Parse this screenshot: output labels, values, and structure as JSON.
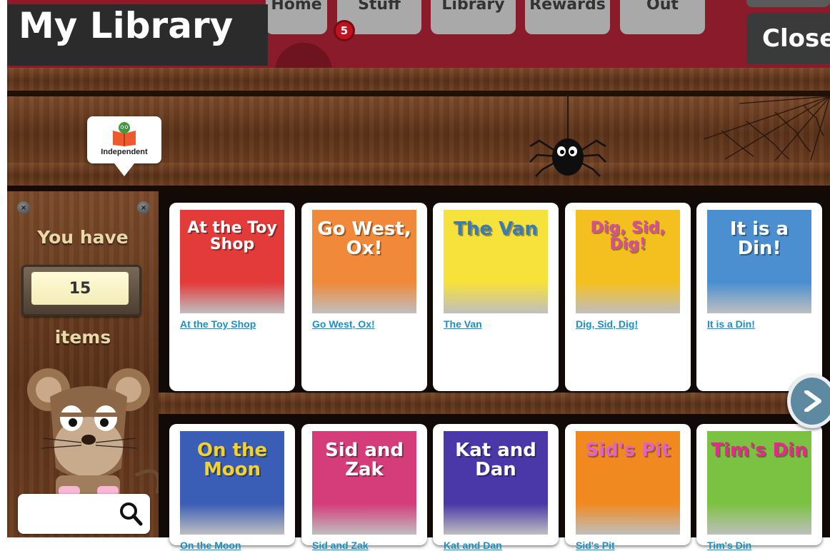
{
  "app": {
    "title": "My Library",
    "close_label": "Close"
  },
  "nav": {
    "tabs": [
      "Home",
      "Stuff",
      "Library",
      "Rewards",
      "Out"
    ],
    "badge_count": "5"
  },
  "shelf": {
    "tag_label": "Independent",
    "tag_icon": "book-icon",
    "decorations": [
      "spider",
      "cobweb"
    ]
  },
  "sidebar": {
    "you_have_label": "You have",
    "count": "15",
    "items_label": "items",
    "mascot": "mouse",
    "search": {
      "placeholder": "",
      "value": "",
      "icon": "search-icon"
    }
  },
  "books": {
    "row1": [
      {
        "title": "At the Toy Shop",
        "cover_text": "At the Toy Shop",
        "cover_color": "#e33a3a",
        "text_color": "#ffffff"
      },
      {
        "title": "Go West, Ox!",
        "cover_text": "Go West, Ox!",
        "cover_color": "#f0893a",
        "text_color": "#ffffff"
      },
      {
        "title": "The Van",
        "cover_text": "The Van",
        "cover_color": "#f7e13b",
        "text_color": "#3b7ab8"
      },
      {
        "title": "Dig, Sid, Dig!",
        "cover_text": "Dig, Sid, Dig!",
        "cover_color": "#f4c020",
        "text_color": "#d94da0"
      },
      {
        "title": "It is a Din!",
        "cover_text": "It is a Din!",
        "cover_color": "#4b8fd0",
        "text_color": "#ffffff"
      }
    ],
    "row2": [
      {
        "title": "On the Moon",
        "cover_text": "On the Moon",
        "cover_color": "#3a5db6",
        "text_color": "#f2d230"
      },
      {
        "title": "Sid and Zak",
        "cover_text": "Sid and Zak",
        "cover_color": "#d43c7a",
        "text_color": "#ffffff"
      },
      {
        "title": "Kat and Dan",
        "cover_text": "Kat and Dan",
        "cover_color": "#4a37a8",
        "text_color": "#ffffff"
      },
      {
        "title": "Sid's Pit",
        "cover_text": "Sid's Pit",
        "cover_color": "#f08a20",
        "text_color": "#e062c8"
      },
      {
        "title": "Tim's Din",
        "cover_text": "Tim's Din",
        "cover_color": "#7cc242",
        "text_color": "#e8288a"
      }
    ]
  },
  "next_icon": "chevron-right-icon",
  "colors": {
    "topbar": "#8a1b2a",
    "title_bg": "#2b2b2b",
    "link": "#1a8fc7",
    "sidebar_text": "#e9d9a8",
    "badge": "#c1121f"
  }
}
